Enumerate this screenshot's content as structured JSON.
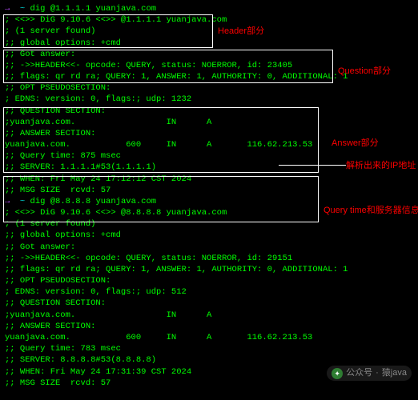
{
  "prompt": {
    "sym": "→",
    "dir": "~"
  },
  "cmd1": "dig @1.1.1.1 yuanjava.com",
  "cmd2": "dig @8.8.8.8 yuanjava.com",
  "out1": {
    "l0": "",
    "l1": "; <<>> DiG 9.10.6 <<>> @1.1.1.1 yuanjava.com",
    "l2": "; (1 server found)",
    "l3": ";; global options: +cmd",
    "l4": ";; Got answer:",
    "l5": ";; ->>HEADER<<- opcode: QUERY, status: NOERROR, id: 23405",
    "l6": ";; flags: qr rd ra; QUERY: 1, ANSWER: 1, AUTHORITY: 0, ADDITIONAL: 1",
    "l7": "",
    "l8": ";; OPT PSEUDOSECTION:",
    "l9": "; EDNS: version: 0, flags:; udp: 1232",
    "l10": ";; QUESTION SECTION:",
    "l11": ";yuanjava.com.                  IN      A",
    "l12": "",
    "l13": ";; ANSWER SECTION:",
    "l14": "yuanjava.com.           600     IN      A       116.62.213.53",
    "l15": "",
    "l16": ";; Query time: 875 msec",
    "l17": ";; SERVER: 1.1.1.1#53(1.1.1.1)",
    "l18": ";; WHEN: Fri May 24 17:12:12 CST 2024",
    "l19": ";; MSG SIZE  rcvd: 57",
    "l20": ""
  },
  "out2": {
    "l0": "",
    "l1": "; <<>> DiG 9.10.6 <<>> @8.8.8.8 yuanjava.com",
    "l2": "; (1 server found)",
    "l3": ";; global options: +cmd",
    "l4": ";; Got answer:",
    "l5": ";; ->>HEADER<<- opcode: QUERY, status: NOERROR, id: 29151",
    "l6": ";; flags: qr rd ra; QUERY: 1, ANSWER: 1, AUTHORITY: 0, ADDITIONAL: 1",
    "l7": "",
    "l8": ";; OPT PSEUDOSECTION:",
    "l9": "; EDNS: version: 0, flags:; udp: 512",
    "l10": ";; QUESTION SECTION:",
    "l11": ";yuanjava.com.                  IN      A",
    "l12": "",
    "l13": ";; ANSWER SECTION:",
    "l14": "yuanjava.com.           600     IN      A       116.62.213.53",
    "l15": "",
    "l16": ";; Query time: 783 msec",
    "l17": ";; SERVER: 8.8.8.8#53(8.8.8.8)",
    "l18": ";; WHEN: Fri May 24 17:31:39 CST 2024",
    "l19": ";; MSG SIZE  rcvd: 57",
    "l20": ""
  },
  "labels": {
    "header": "Header部分",
    "question": "Question部分",
    "answer": "Answer部分",
    "ip": "解析出来的IP地址",
    "qtime": "Query time和服务器信息"
  },
  "watermark": {
    "prefix": "公众号",
    "name": "猿java"
  }
}
